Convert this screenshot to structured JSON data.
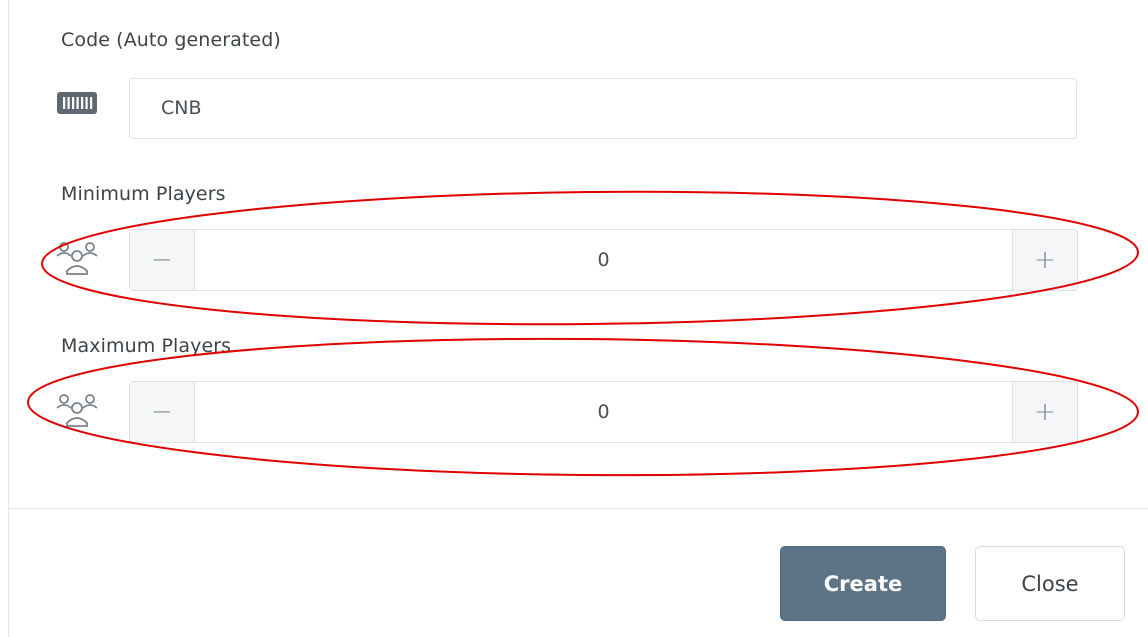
{
  "form": {
    "code": {
      "label": "Code (Auto generated)",
      "value": "CNB",
      "icon": "barcode-icon"
    },
    "min_players": {
      "label": "Minimum Players",
      "value": "0",
      "icon": "group-icon",
      "decrement_label": "−",
      "increment_label": "+"
    },
    "max_players": {
      "label": "Maximum Players",
      "value": "0",
      "icon": "group-icon",
      "decrement_label": "−",
      "increment_label": "+"
    }
  },
  "footer": {
    "create_label": "Create",
    "close_label": "Close"
  },
  "colors": {
    "primary_button": "#5d7487",
    "annotation_ellipse": "#e00000"
  }
}
